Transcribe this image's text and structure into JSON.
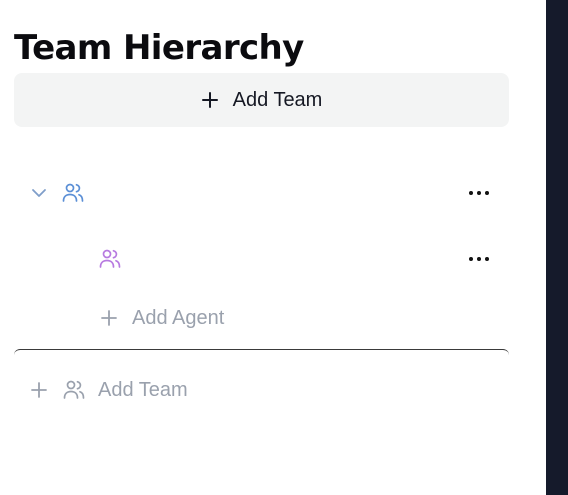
{
  "header": {
    "title": "Team Hierarchy"
  },
  "toolbar": {
    "add_team_label": "Add Team"
  },
  "tree": {
    "team": {
      "name": "",
      "icon": "users-icon",
      "icon_color": "#5b8fd6",
      "expanded": true,
      "agents": [
        {
          "name": "",
          "icon": "users-icon",
          "icon_color": "#b77ae0"
        }
      ],
      "add_agent_label": "Add Agent"
    }
  },
  "footer": {
    "add_team_label": "Add Team"
  },
  "colors": {
    "sidebar_dark": "#151a2b",
    "button_bg": "#f3f4f4",
    "muted_text": "#9aa1ad"
  }
}
